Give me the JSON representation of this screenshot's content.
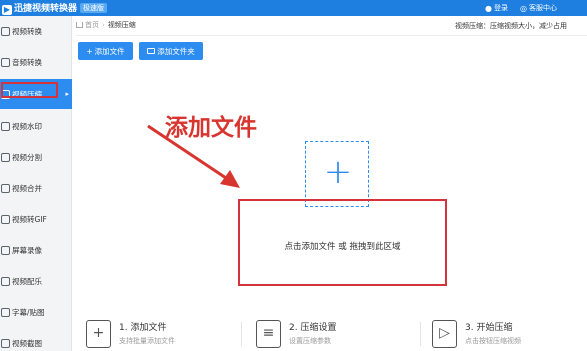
{
  "window": {
    "title": "迅捷视频转换器",
    "edition": "极速版",
    "top_links": [
      "登录",
      "客服中心"
    ]
  },
  "sidebar": {
    "items": [
      {
        "label": "视频转换"
      },
      {
        "label": "音频转换"
      },
      {
        "label": "视频压缩",
        "active": true
      },
      {
        "label": "视频水印"
      },
      {
        "label": "视频分割"
      },
      {
        "label": "视频合并"
      },
      {
        "label": "视频转GIF"
      },
      {
        "label": "屏幕录像"
      },
      {
        "label": "视频配乐"
      },
      {
        "label": "字幕/贴图"
      },
      {
        "label": "视频截图"
      }
    ]
  },
  "breadcrumb": {
    "home": "首页",
    "current": "视频压缩"
  },
  "page_description": "视频压缩：压缩视频大小，减少占用",
  "toolbar": {
    "add_file": "添加文件",
    "add_folder": "添加文件夹"
  },
  "annotation": {
    "text": "添加文件",
    "color": "#d8352f"
  },
  "dropzone": {
    "plus": "+",
    "hint": "点击添加文件 或 拖拽到此区域"
  },
  "steps": [
    {
      "title": "1. 添加文件",
      "desc": "支持批量添加文件",
      "icon": "add-file-icon"
    },
    {
      "title": "2. 压缩设置",
      "desc": "设置压缩参数",
      "icon": "zip-settings-icon"
    },
    {
      "title": "3. 开始压缩",
      "desc": "点击按钮压缩视频",
      "icon": "play-icon"
    }
  ],
  "colors": {
    "accent": "#2d8cf0",
    "titlebar": "#1e7fe0",
    "highlight": "#d4333b"
  }
}
